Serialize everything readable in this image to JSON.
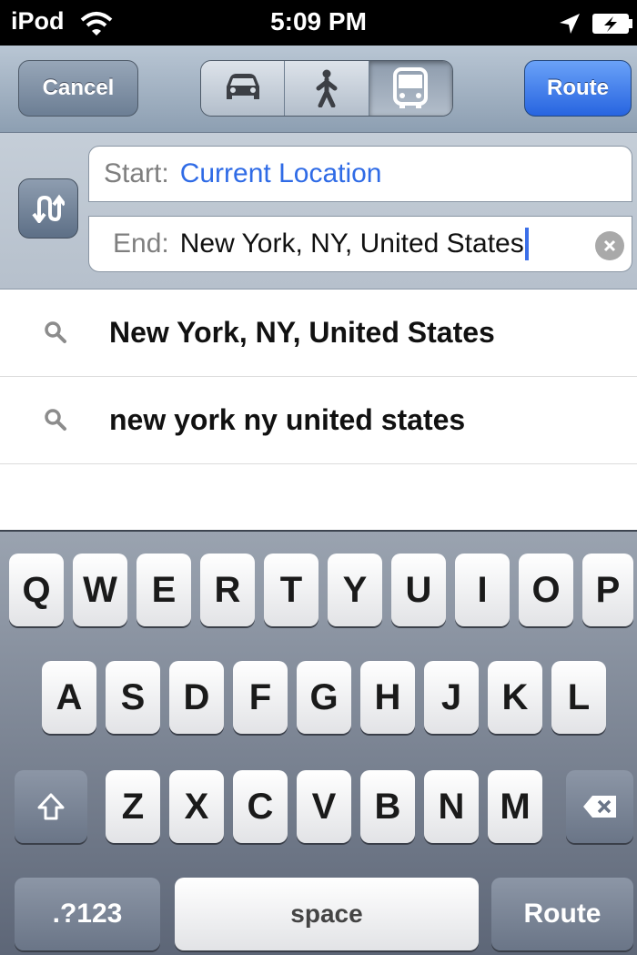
{
  "status_bar": {
    "carrier": "iPod",
    "time": "5:09 PM",
    "icons": [
      "wifi-icon",
      "location-arrow-icon",
      "battery-charging-icon"
    ]
  },
  "nav": {
    "cancel_label": "Cancel",
    "route_label": "Route",
    "modes": [
      {
        "name": "car-icon",
        "selected": false
      },
      {
        "name": "walking-icon",
        "selected": false
      },
      {
        "name": "bus-icon",
        "selected": true
      }
    ]
  },
  "directions": {
    "start_label": "Start:",
    "start_value": "Current Location",
    "end_label": "End:",
    "end_value": "New York, NY, United States"
  },
  "suggestions": [
    {
      "text": "New York, NY, United States"
    },
    {
      "text": "new york ny united states"
    }
  ],
  "keyboard": {
    "row1": [
      "Q",
      "W",
      "E",
      "R",
      "T",
      "Y",
      "U",
      "I",
      "O",
      "P"
    ],
    "row2": [
      "A",
      "S",
      "D",
      "F",
      "G",
      "H",
      "J",
      "K",
      "L"
    ],
    "row3": [
      "Z",
      "X",
      "C",
      "V",
      "B",
      "N",
      "M"
    ],
    "numbers_label": ".?123",
    "space_label": "space",
    "return_label": "Route"
  },
  "colors": {
    "accent_blue": "#2f6be6",
    "route_button": "#2764e0",
    "nav_bar": "#a3b2c3"
  }
}
